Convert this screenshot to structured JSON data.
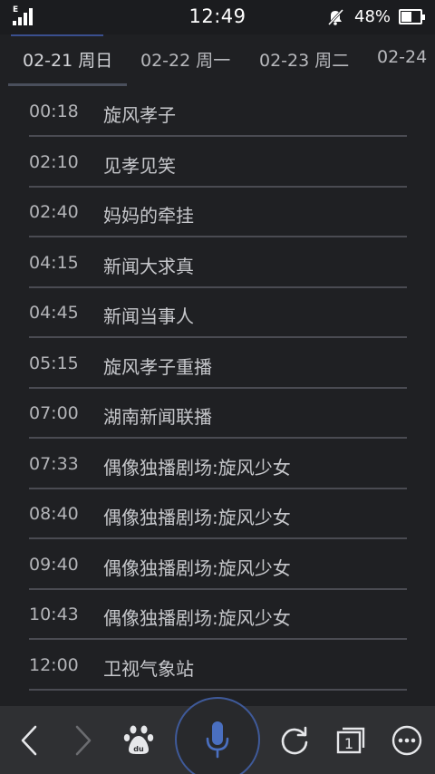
{
  "status_bar": {
    "network_type": "E",
    "time": "12:49",
    "battery_percent": "48%",
    "battery_level": 0.48,
    "icons": [
      "signal-icon",
      "mute-icon",
      "battery-icon"
    ]
  },
  "date_tabs": [
    {
      "label": "02-21 周日",
      "active": true
    },
    {
      "label": "02-22 周一",
      "active": false
    },
    {
      "label": "02-23 周二",
      "active": false
    },
    {
      "label": "02-24",
      "active": false
    }
  ],
  "schedule": [
    {
      "time": "00:18",
      "title": "旋风孝子"
    },
    {
      "time": "02:10",
      "title": "见孝见笑"
    },
    {
      "time": "02:40",
      "title": "妈妈的牵挂"
    },
    {
      "time": "04:15",
      "title": "新闻大求真"
    },
    {
      "time": "04:45",
      "title": "新闻当事人"
    },
    {
      "time": "05:15",
      "title": "旋风孝子重播"
    },
    {
      "time": "07:00",
      "title": "湖南新闻联播"
    },
    {
      "time": "07:33",
      "title": "偶像独播剧场:旋风少女"
    },
    {
      "time": "08:40",
      "title": "偶像独播剧场:旋风少女"
    },
    {
      "time": "09:40",
      "title": "偶像独播剧场:旋风少女"
    },
    {
      "time": "10:43",
      "title": "偶像独播剧场:旋风少女"
    },
    {
      "time": "12:00",
      "title": "卫视气象站"
    }
  ],
  "toolbar": {
    "tab_count": "1",
    "baidu_text": "du",
    "icons": [
      "back-icon",
      "forward-icon",
      "baidu-paw-icon",
      "microphone-icon",
      "refresh-icon",
      "tabs-icon",
      "more-icon"
    ]
  },
  "colors": {
    "background": "#1f2023",
    "toolbar": "#2f3033",
    "accent": "#3f5a9a",
    "divider": "#4a4b52",
    "text": "#c6c7cb"
  }
}
